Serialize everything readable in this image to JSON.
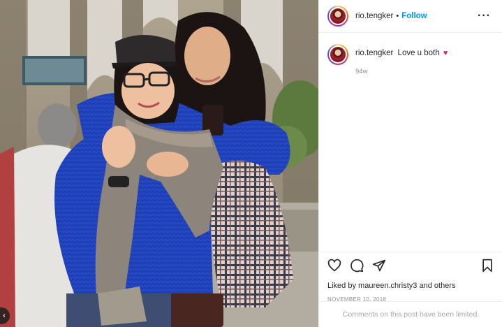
{
  "post": {
    "username": "rio.tengker",
    "dot": "•",
    "follow_label": "Follow",
    "more_icon": "more-icon",
    "more_label": "···"
  },
  "caption": {
    "username": "rio.tengker",
    "text": "Love u both",
    "emoji": "♥",
    "emoji_color": "#e0245e",
    "age": "94w"
  },
  "actions": {
    "icons": [
      "heart-icon",
      "comment-icon",
      "share-icon",
      "bookmark-icon"
    ],
    "liked_by_prefix": "Liked by",
    "liked_by_user": "maureen.christy3",
    "liked_by_suffix": "and others",
    "date": "NOVEMBER 10, 2018"
  },
  "footer": {
    "limited_text": "Comments on this post have been limited."
  },
  "photo": {
    "prev_icon": "chevron-left-icon",
    "prev_label": "‹"
  },
  "colors": {
    "accent": "#0095f6",
    "muted": "#8e8e8e",
    "border": "#efefef"
  }
}
